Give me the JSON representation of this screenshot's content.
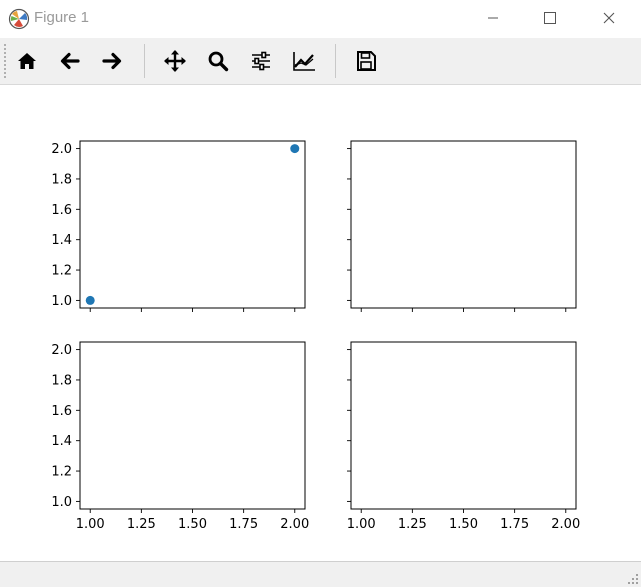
{
  "window": {
    "title": "Figure 1",
    "app_icon": "matplotlib-icon",
    "controls": [
      "minimize-icon",
      "maximize-icon",
      "close-icon"
    ]
  },
  "toolbar": {
    "buttons": [
      {
        "name": "home-button",
        "icon": "home-icon"
      },
      {
        "name": "back-button",
        "icon": "arrow-left-icon"
      },
      {
        "name": "forward-button",
        "icon": "arrow-right-icon"
      },
      {
        "name": "pan-button",
        "icon": "move-icon"
      },
      {
        "name": "zoom-button",
        "icon": "magnifier-icon"
      },
      {
        "name": "subplots-button",
        "icon": "sliders-icon"
      },
      {
        "name": "edit-axes-button",
        "icon": "line-chart-icon"
      },
      {
        "name": "save-button",
        "icon": "floppy-disk-icon"
      }
    ]
  },
  "status": {
    "text": ""
  },
  "chart_data": [
    {
      "type": "scatter",
      "position": "top-left",
      "series": [
        {
          "x": [
            1.0,
            2.0
          ],
          "y": [
            1.0,
            2.0
          ],
          "color": "#1f77b4"
        }
      ],
      "xlim": [
        0.95,
        2.05
      ],
      "ylim": [
        0.95,
        2.05
      ],
      "xticks": [
        "1.00",
        "1.25",
        "1.50",
        "1.75",
        "2.00"
      ],
      "xtick_labels_shown": false,
      "yticks": [
        "1.0",
        "1.2",
        "1.4",
        "1.6",
        "1.8",
        "2.0"
      ],
      "ytick_labels_shown": true
    },
    {
      "type": "scatter",
      "position": "top-right",
      "series": [],
      "xlim": [
        0.95,
        2.05
      ],
      "ylim": [
        0.95,
        2.05
      ],
      "xticks": [
        "1.00",
        "1.25",
        "1.50",
        "1.75",
        "2.00"
      ],
      "xtick_labels_shown": false,
      "yticks": [
        "1.0",
        "1.2",
        "1.4",
        "1.6",
        "1.8",
        "2.0"
      ],
      "ytick_labels_shown": false
    },
    {
      "type": "scatter",
      "position": "bottom-left",
      "series": [],
      "xlim": [
        0.95,
        2.05
      ],
      "ylim": [
        0.95,
        2.05
      ],
      "xticks": [
        "1.00",
        "1.25",
        "1.50",
        "1.75",
        "2.00"
      ],
      "xtick_labels_shown": true,
      "yticks": [
        "1.0",
        "1.2",
        "1.4",
        "1.6",
        "1.8",
        "2.0"
      ],
      "ytick_labels_shown": true
    },
    {
      "type": "scatter",
      "position": "bottom-right",
      "series": [],
      "xlim": [
        0.95,
        2.05
      ],
      "ylim": [
        0.95,
        2.05
      ],
      "xticks": [
        "1.00",
        "1.25",
        "1.50",
        "1.75",
        "2.00"
      ],
      "xtick_labels_shown": true,
      "yticks": [
        "1.0",
        "1.2",
        "1.4",
        "1.6",
        "1.8",
        "2.0"
      ],
      "ytick_labels_shown": false
    }
  ]
}
